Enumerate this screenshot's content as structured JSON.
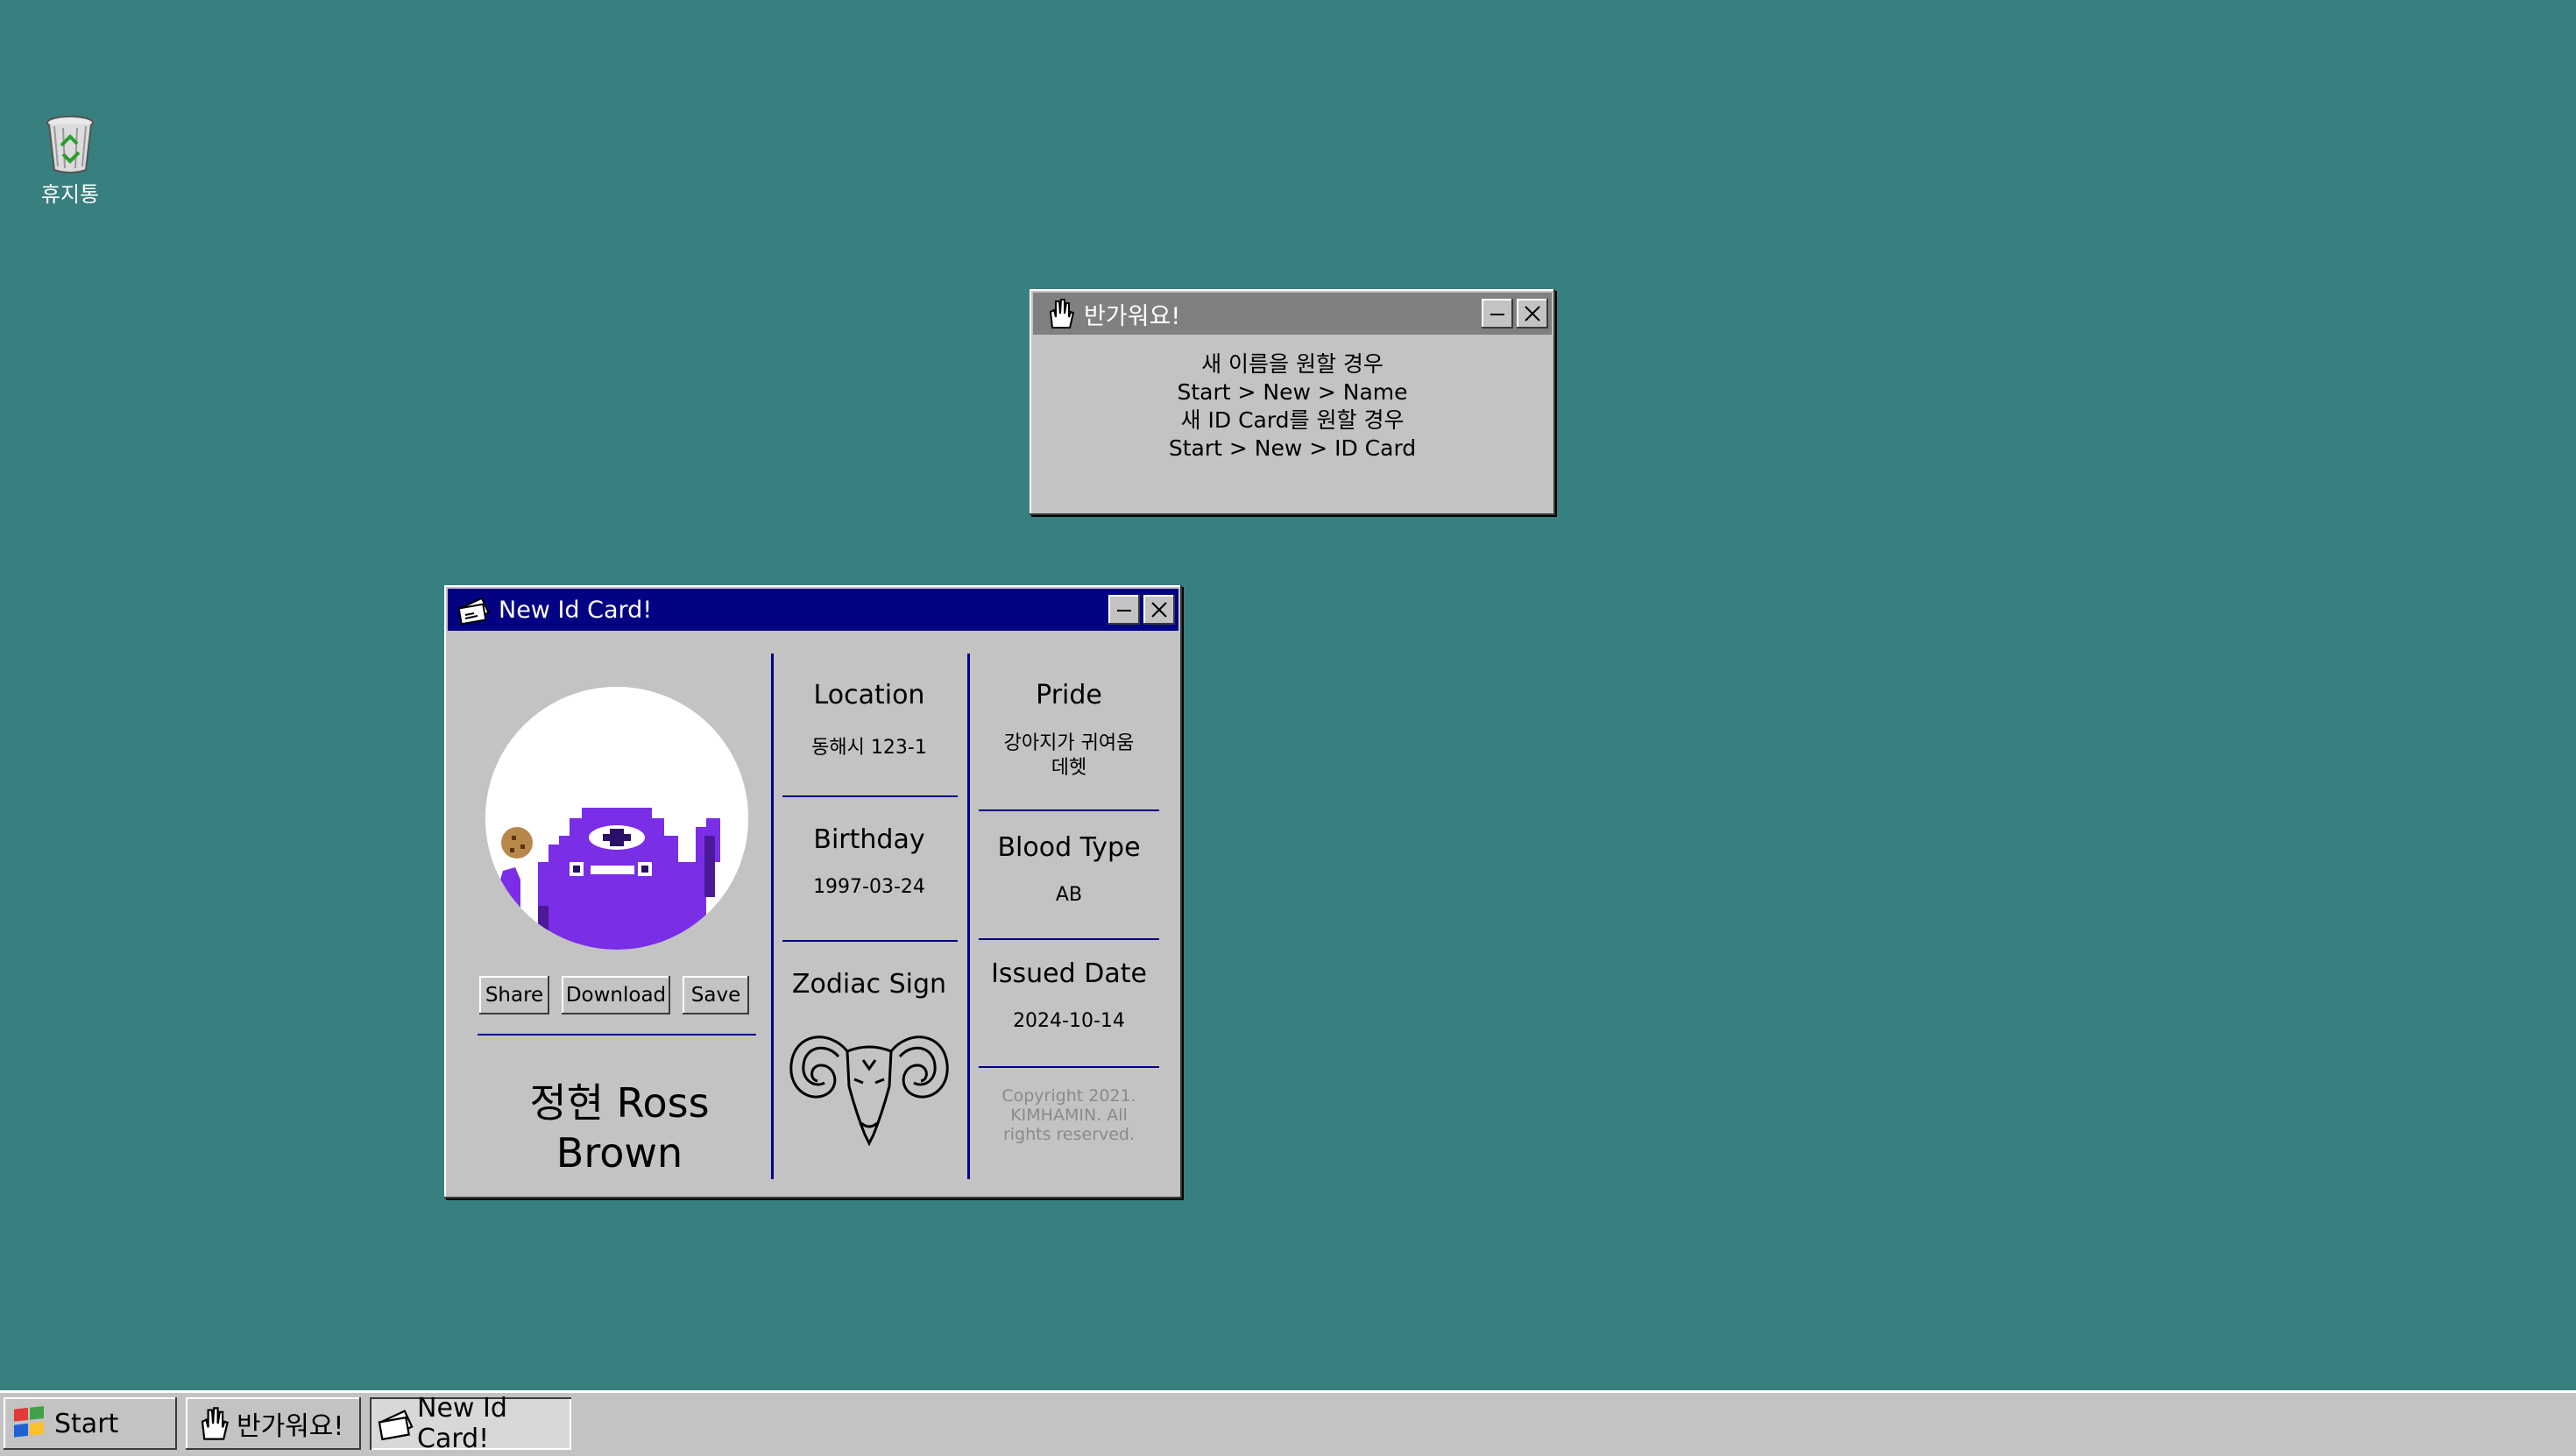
{
  "desktop": {
    "background_color": "#387f7f",
    "icons": [
      {
        "label": "휴지통",
        "icon": "recycle-bin-icon"
      }
    ]
  },
  "welcome_window": {
    "title": "반가워요!",
    "icon": "hand-icon",
    "lines": [
      "새 이름을 원할 경우",
      "Start > New > Name",
      "새 ID Card를 원할 경우",
      "Start > New > ID Card"
    ]
  },
  "id_window": {
    "title": "New Id Card!",
    "icon": "id-card-icon",
    "avatar_icon": "purple-monster-avatar",
    "buttons": {
      "share": "Share",
      "download": "Download",
      "save": "Save"
    },
    "name": "정현 Ross Brown",
    "fields": {
      "location": {
        "label": "Location",
        "value": "동해시 123-1"
      },
      "birthday": {
        "label": "Birthday",
        "value": "1997-03-24"
      },
      "zodiac": {
        "label": "Zodiac Sign",
        "icon": "ram-aries-icon"
      },
      "pride": {
        "label": "Pride",
        "value": "강아지가 귀여움 데헷"
      },
      "blood_type": {
        "label": "Blood Type",
        "value": "AB"
      },
      "issued_date": {
        "label": "Issued Date",
        "value": "2024-10-14"
      }
    },
    "copyright": "Copyright 2021. KIMHAMIN. All rights reserved.",
    "accent_color": "#020283"
  },
  "taskbar": {
    "start_label": "Start",
    "items": [
      {
        "label": "반가워요!",
        "icon": "hand-icon"
      },
      {
        "label": "New Id Card!",
        "icon": "id-card-icon"
      }
    ]
  }
}
